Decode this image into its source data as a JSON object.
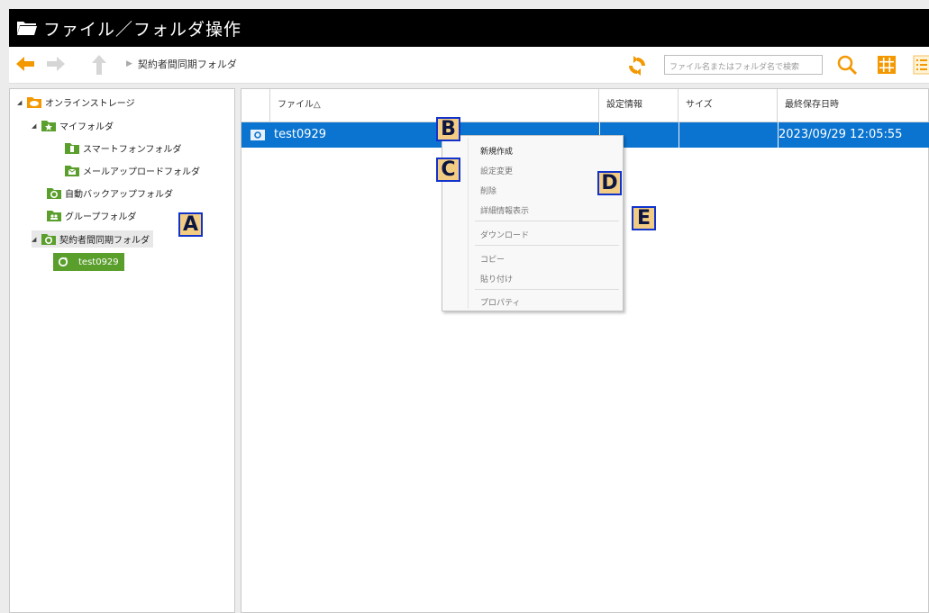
{
  "window": {
    "title": "ファイル／フォルダ操作"
  },
  "toolbar": {
    "breadcrumb": "契約者間同期フォルダ",
    "search_placeholder": "ファイル名またはフォルダ名で検索"
  },
  "tree": {
    "items": [
      {
        "label": "オンラインストレージ",
        "icon": "cloud-folder-icon"
      },
      {
        "label": "マイフォルダ",
        "icon": "star-folder-icon"
      },
      {
        "label": "スマートフォンフォルダ",
        "icon": "smartphone-folder-icon"
      },
      {
        "label": "メールアップロードフォルダ",
        "icon": "mail-folder-icon"
      },
      {
        "label": "自動バックアップフォルダ",
        "icon": "backup-folder-icon"
      },
      {
        "label": "グループフォルダ",
        "icon": "group-folder-icon"
      },
      {
        "label": "契約者間同期フォルダ",
        "icon": "sync-folder-icon"
      },
      {
        "label": "test0929",
        "icon": "sync-folder-icon"
      }
    ]
  },
  "table": {
    "columns": [
      "ファイル△",
      "設定情報",
      "サイズ",
      "最終保存日時"
    ],
    "rows": [
      {
        "name": "test0929",
        "settings": "",
        "size": "",
        "modified": "2023/09/29 12:05:55",
        "selected": true
      }
    ]
  },
  "context_menu": {
    "items": [
      {
        "label": "新規作成",
        "enabled": true
      },
      {
        "label": "設定変更",
        "enabled": false
      },
      {
        "label": "削除",
        "enabled": false
      },
      {
        "label": "詳細情報表示",
        "enabled": false
      },
      {
        "label": "ダウンロード",
        "enabled": false
      },
      {
        "label": "コピー",
        "enabled": false
      },
      {
        "label": "貼り付け",
        "enabled": false
      },
      {
        "label": "プロパティ",
        "enabled": false
      }
    ]
  },
  "markers": [
    "A",
    "B",
    "C",
    "D",
    "E"
  ],
  "colors": {
    "accent_orange": "#f39800",
    "selection_blue": "#0a74d0",
    "folder_green": "#5a9e2c",
    "marker_fill": "#f3cc84",
    "marker_border": "#1133cc"
  }
}
